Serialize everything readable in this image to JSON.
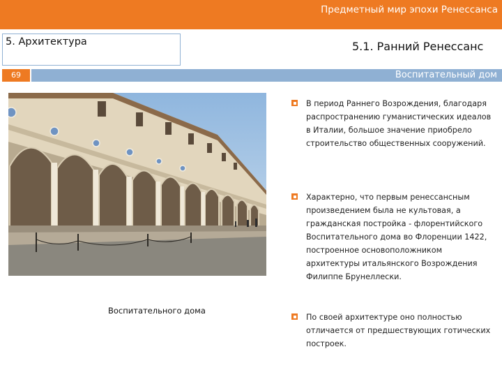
{
  "header": {
    "title": "Предметный мир эпохи Ренессанса",
    "accent_color": "#ee7a22"
  },
  "section": {
    "label": "5. Архитектура",
    "subsection": "5.1. Ранний Ренессанс",
    "border_color": "#8fb0d3"
  },
  "slide": {
    "page_number": "69",
    "topic": "Воспитательный дом"
  },
  "figure": {
    "caption": "Воспитательного дома"
  },
  "bullets": [
    {
      "marker": "square-bullet-icon",
      "text": "В период Раннего Возрождения, благодаря распространению гуманистических идеалов в Италии, большое значение приобрело строительство общественных сооружений."
    },
    {
      "marker": "square-bullet-icon",
      "text": " Характерно, что первым ренессансным произведением была не культовая, а гражданская постройка - флорентийского Воспитательного дома во Флоренции 1422, построенное основоположником архитектуры итальянского Возрождения Филиппе Брунеллески."
    },
    {
      "marker": "square-bullet-icon",
      "text": "По своей архитектуре оно полностью отличается от предшествующих готических построек."
    }
  ]
}
